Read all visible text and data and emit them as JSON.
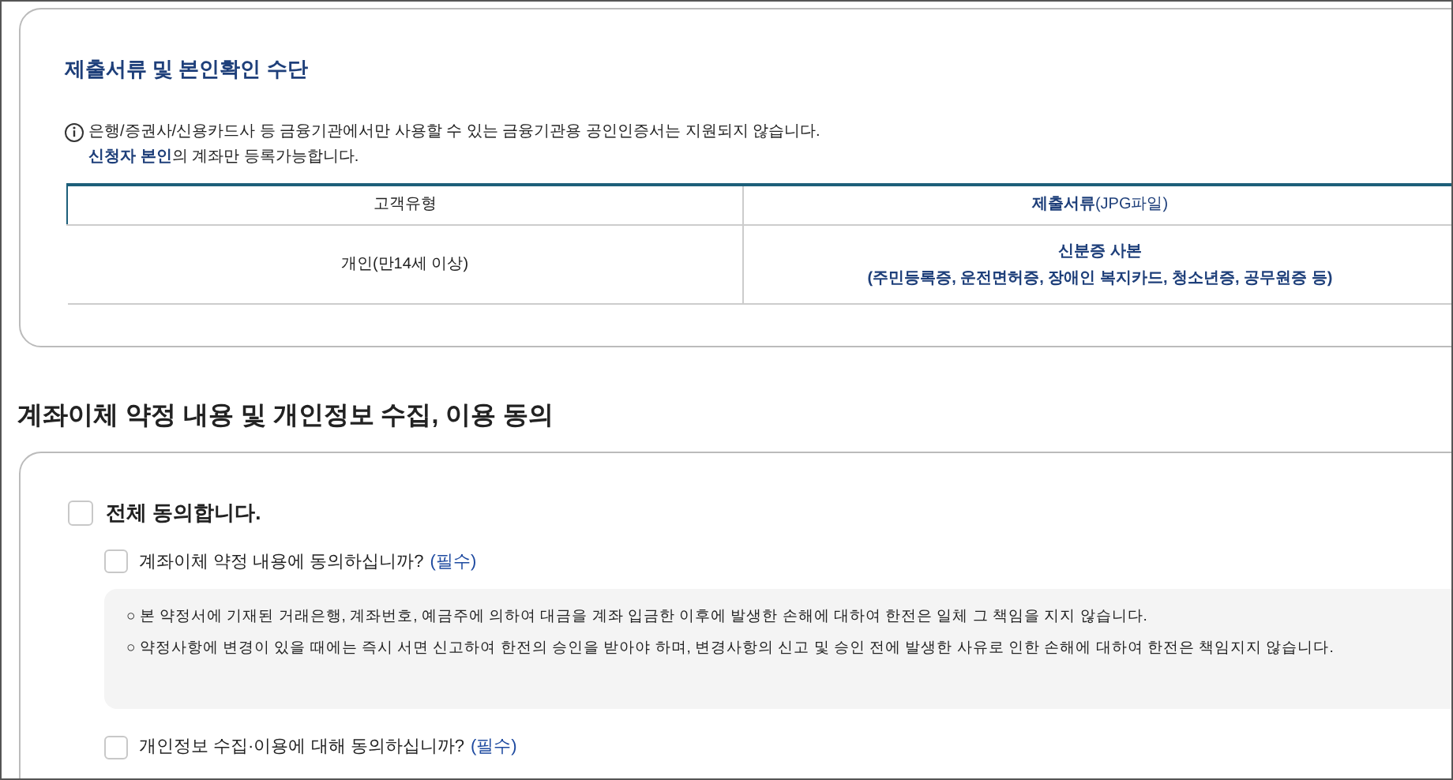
{
  "documents": {
    "title": "제출서류 및 본인확인 수단",
    "notices": [
      "은행/증권사/신용카드사 등 금융기관에서만 사용할 수 있는 금융기관용 공인인증서는 지원되지 않습니다.",
      "**신청자 본인**의 계좌만 등록가능합니다."
    ],
    "table": {
      "columns": [
        "고객유형",
        "**제출서류**(JPG파일)"
      ],
      "rows": [
        [
          "개인(만14세 이상)",
          "신분증 사본\n(주민등록증, 운전면허증, 장애인 복지카드, 청소년증, 공무원증 등)"
        ]
      ]
    }
  },
  "consent": {
    "heading": "계좌이체 약정 내용 및 개인정보 수집, 이용 동의",
    "all": {
      "label": "전체 동의합니다.",
      "checked": false
    },
    "items": [
      {
        "label": "계좌이체 약정 내용에 동의하십니까?",
        "required": "(필수)",
        "checked": false,
        "terms": [
          "○ 본 약정서에 기재된 거래은행, 계좌번호, 예금주에 의하여 대금을 계좌 입금한 이후에 발생한 손해에 대하여 한전은 일체 그 책임을 지지 않습니다.",
          "○ 약정사항에 변경이 있을 때에는 즉시 서면 신고하여 한전의 승인을 받아야 하며, 변경사항의 신고 및 승인 전에 발생한 사유로 인한 손해에 대하여 한전은 책임지지 않습니다."
        ]
      },
      {
        "label": "개인정보 수집·이용에 대해 동의하십니까?",
        "required": "(필수)",
        "checked": false
      }
    ]
  }
}
